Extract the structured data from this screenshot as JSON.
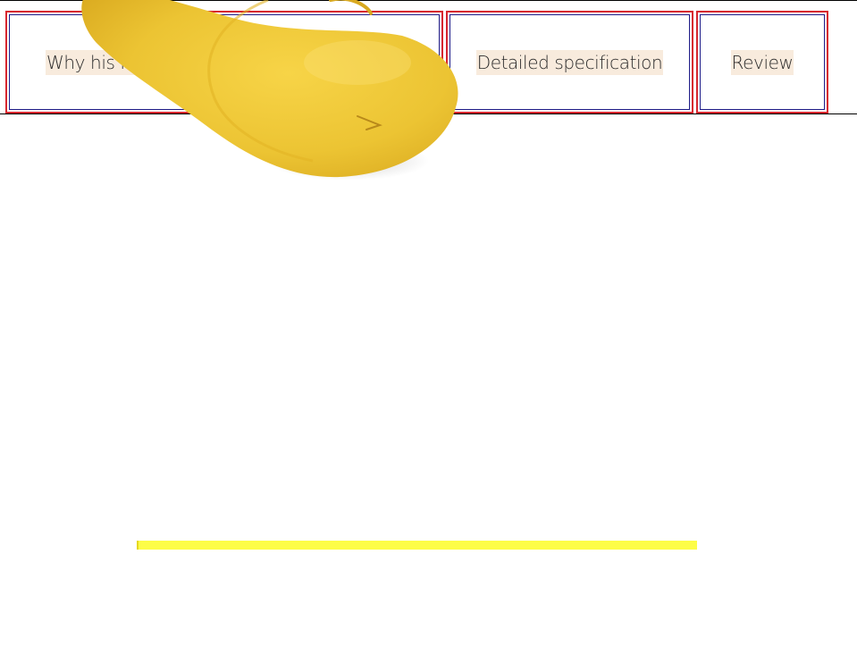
{
  "tabs": [
    {
      "label": "Why his name is..."
    },
    {
      "label": "Detailed specification"
    },
    {
      "label": "Review"
    }
  ],
  "progress": {
    "value": 1.0
  },
  "colors": {
    "tab_border": "#d7262e",
    "tab_inner_border": "#1e1e8a",
    "label_highlight": "#f8ebdd",
    "progress_fill": "#fdfd47",
    "duck_body": "#f0c93a"
  },
  "decoration": {
    "icon": "rubber-duck-bill-icon"
  }
}
